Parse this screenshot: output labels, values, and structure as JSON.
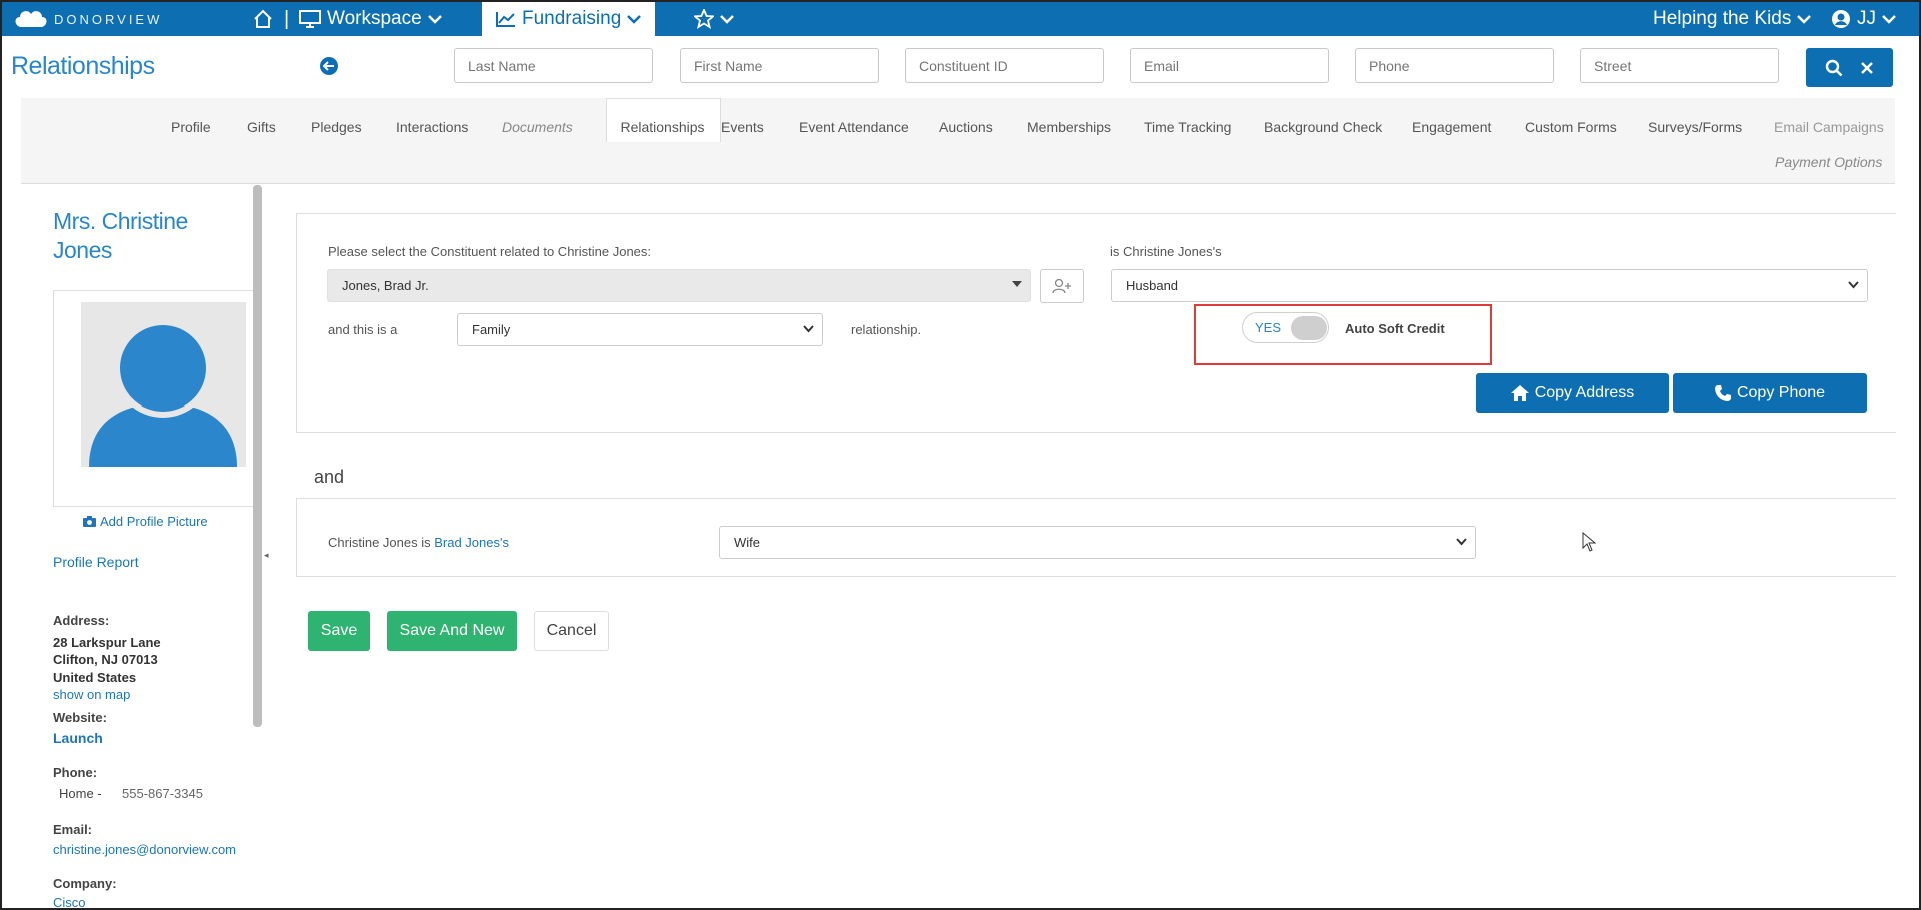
{
  "topnav": {
    "logo": "DONORVIEW",
    "workspace": "Workspace",
    "fundraising": "Fundraising",
    "org": "Helping the Kids",
    "user": "JJ"
  },
  "header": {
    "title": "Relationships",
    "search": {
      "last_name": "Last Name",
      "first_name": "First Name",
      "constituent_id": "Constituent ID",
      "email": "Email",
      "phone": "Phone",
      "street": "Street"
    }
  },
  "tabs": {
    "profile": "Profile",
    "gifts": "Gifts",
    "pledges": "Pledges",
    "interactions": "Interactions",
    "documents": "Documents",
    "relationships": "Relationships",
    "events": "Events",
    "event_attendance": "Event Attendance",
    "auctions": "Auctions",
    "memberships": "Memberships",
    "time_tracking": "Time Tracking",
    "background_check": "Background Check",
    "engagement": "Engagement",
    "custom_forms": "Custom Forms",
    "surveys_forms": "Surveys/Forms",
    "email_campaigns": "Email Campaigns",
    "payment_options": "Payment Options"
  },
  "sidebar": {
    "name": "Mrs. Christine Jones",
    "add_picture": "Add Profile Picture",
    "profile_report": "Profile Report",
    "address_label": "Address:",
    "address_line1": "28 Larkspur Lane",
    "address_line2": "Clifton, NJ 07013",
    "address_line3": "United States",
    "show_map": "show on map",
    "website_label": "Website:",
    "website_link": "Launch",
    "phone_label": "Phone:",
    "phone_type": "Home -",
    "phone_value": "555-867-3345",
    "email_label": "Email:",
    "email_value": "christine.jones@donorview.com",
    "company_label": "Company:",
    "company_value": "Cisco"
  },
  "form": {
    "select_prompt": "Please select the Constituent related to Christine Jones:",
    "constituent_value": "Jones, Brad Jr.",
    "is_label": "is Christine Jones's",
    "relation_value": "Husband",
    "and_this_label": "and this is a",
    "type_value": "Family",
    "relationship_suffix": "relationship.",
    "toggle_label": "YES",
    "auto_soft_credit": "Auto Soft Credit",
    "copy_address": "Copy Address",
    "copy_phone": "Copy Phone",
    "and_text": "and",
    "reverse_prefix": "Christine Jones is",
    "reverse_link": "Brad Jones's",
    "reverse_value": "Wife"
  },
  "actions": {
    "save": "Save",
    "save_new": "Save And New",
    "cancel": "Cancel"
  },
  "colors": {
    "brand_blue": "#0d6fb2",
    "link_blue": "#2a86cc",
    "save_green": "#2eb370",
    "highlight_red": "#e03a3a"
  }
}
